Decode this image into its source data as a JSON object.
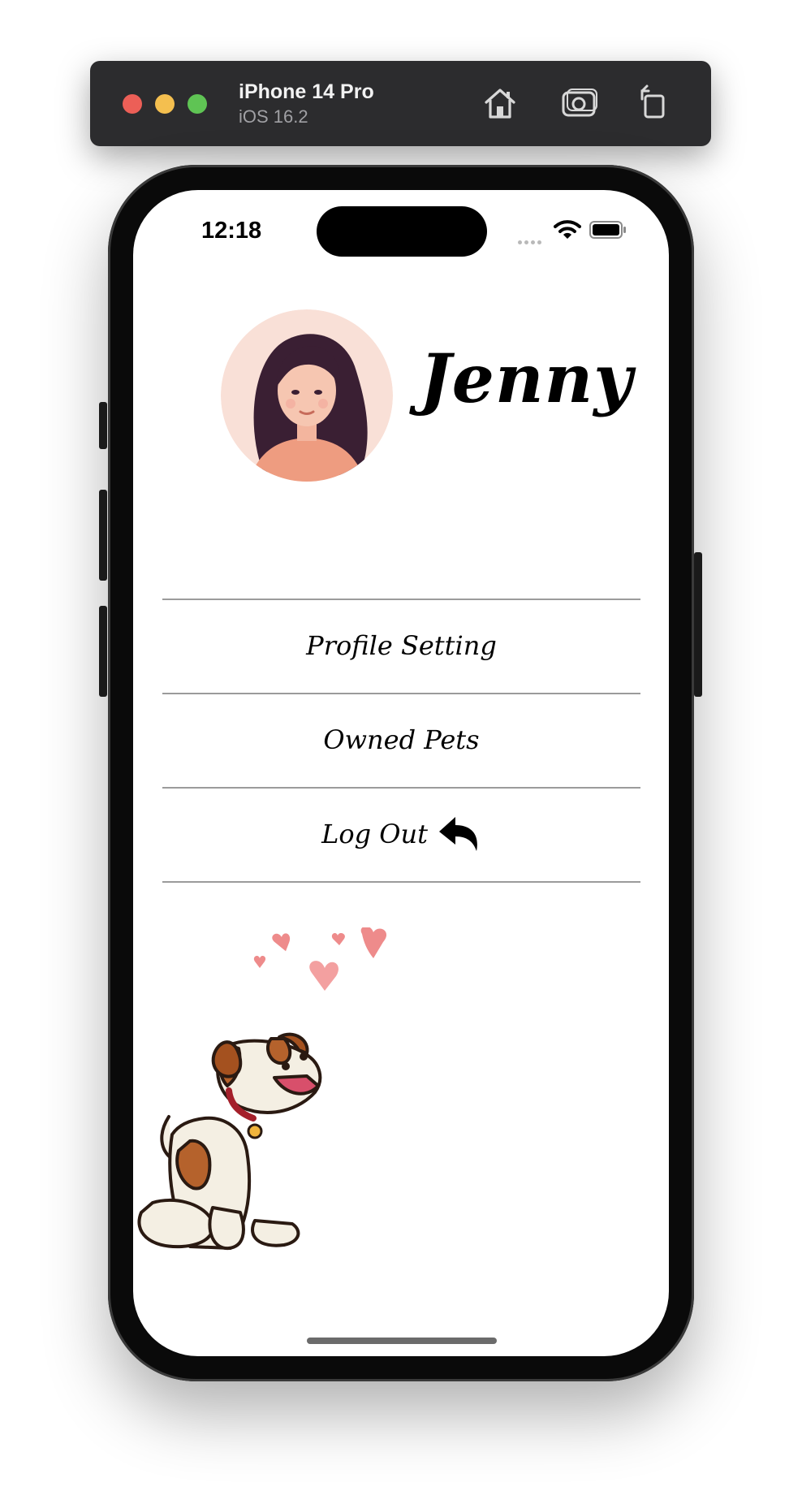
{
  "simulator": {
    "device_name": "iPhone 14 Pro",
    "os_version": "iOS 16.2",
    "icons": [
      "home-icon",
      "screenshot-icon",
      "rotate-icon"
    ],
    "traffic_lights": {
      "close": "#ec5f57",
      "minimize": "#f4bf4f",
      "zoom": "#5fc454"
    }
  },
  "status_bar": {
    "time": "12:18",
    "icons": [
      "cellular-icon",
      "wifi-icon",
      "battery-icon"
    ]
  },
  "profile": {
    "name": "Jenny",
    "avatar_icon": "woman-avatar"
  },
  "menu": {
    "items": [
      {
        "label": "Profile Setting"
      },
      {
        "label": "Owned Pets"
      },
      {
        "label": "Log Out",
        "icon": "reply-arrow-icon"
      }
    ]
  },
  "illustration": {
    "subject": "dog-illustration",
    "decoration": "hearts-illustration"
  },
  "colors": {
    "screen_bg": "#ffffff",
    "divider": "#9b9b9b",
    "heart": "#ee8b8b",
    "avatar_bg": "#f9e0d7"
  }
}
